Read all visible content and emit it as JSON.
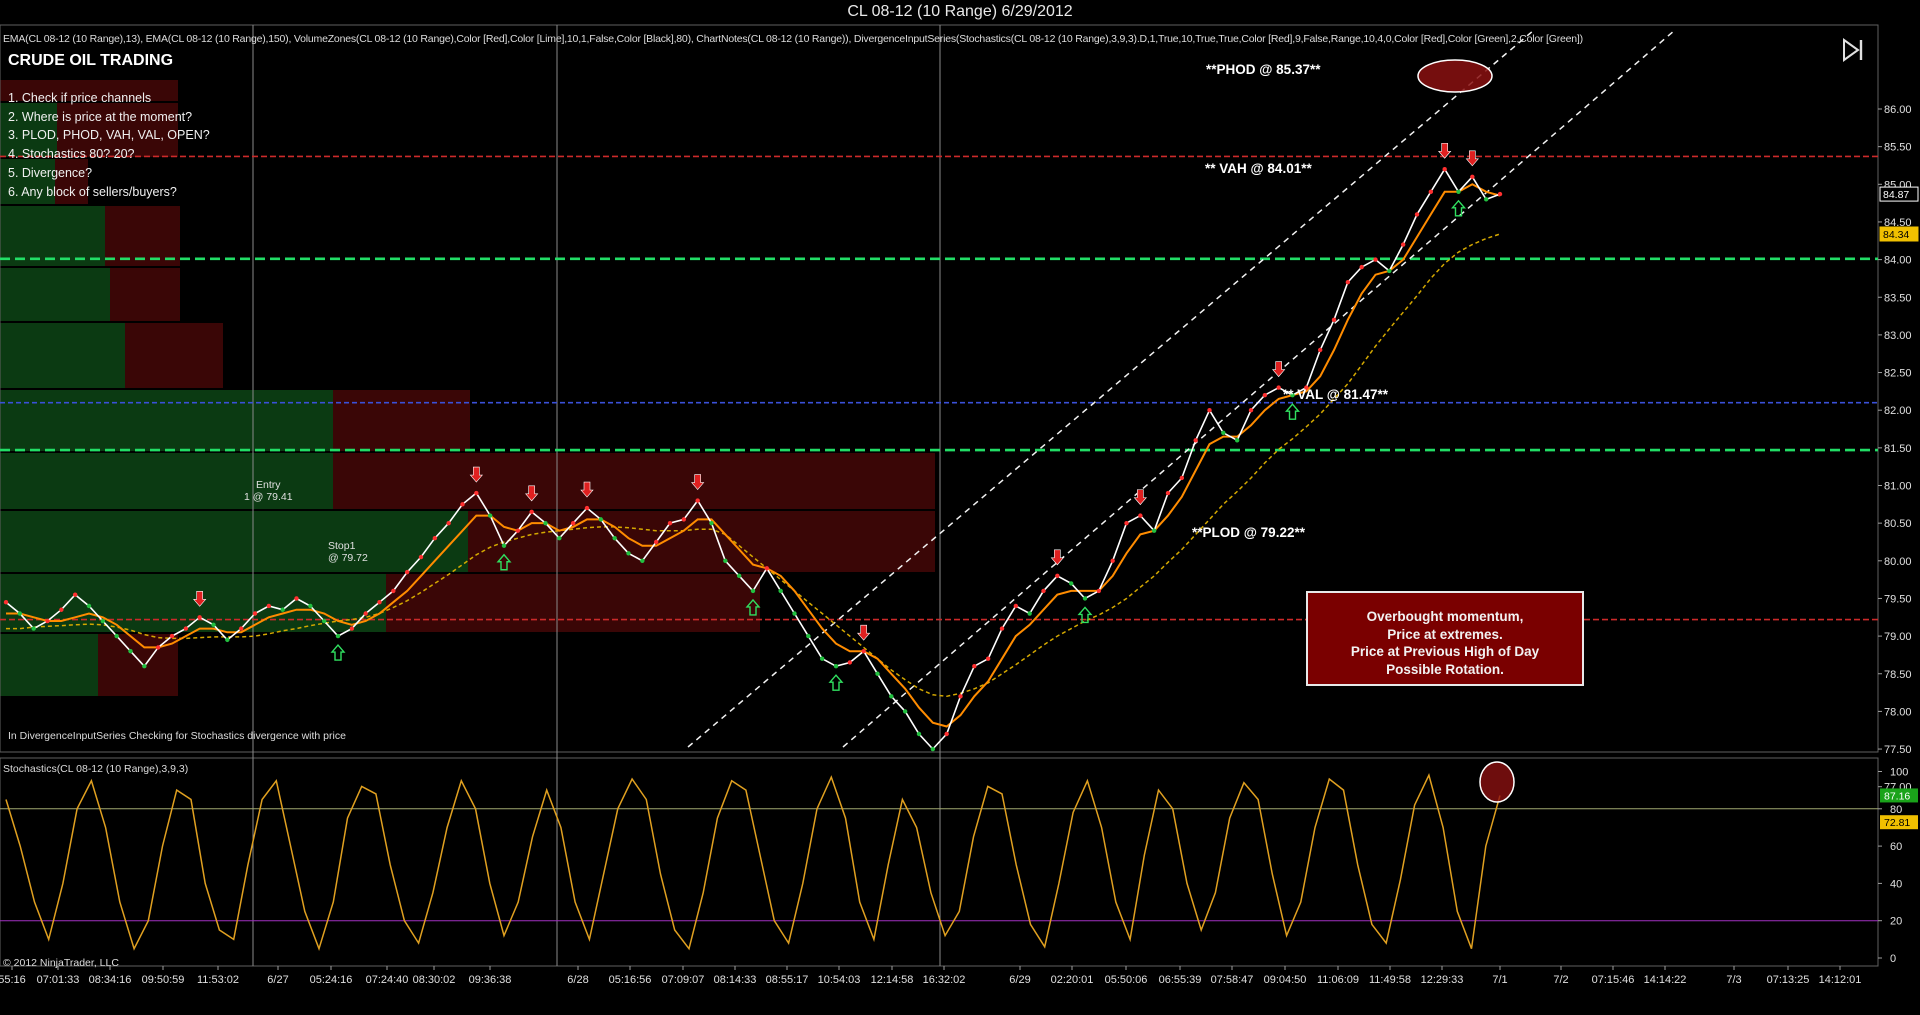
{
  "window": {
    "title": "CL 08-12 (10 Range)  6/29/2012"
  },
  "indicators_line": "EMA(CL 08-12 (10 Range),13), EMA(CL 08-12 (10 Range),150), VolumeZones(CL 08-12 (10 Range),Color [Red],Color [Lime],10,1,False,Color [Black],80), ChartNotes(CL 08-12 (10 Range)), DivergenceInputSeries(Stochastics(CL 08-12 (10 Range),3,9,3).D,1,True,10,True,True,Color [Red],9,False,Range,10,4,0,Color [Red],Color [Green],2,Color [Green])",
  "notes": {
    "title": "CRUDE OIL TRADING",
    "checklist": [
      "1. Check if price channels",
      "2. Where is price at the moment?",
      "3. PLOD, PHOD, VAH, VAL, OPEN?",
      "4. Stochastics 80? 20?",
      "5. Divergence?",
      "6. Any block of sellers/buyers?"
    ],
    "phod": "**PHOD @ 85.37**",
    "vah": "** VAH @ 84.01**",
    "val": "** VAL @ 81.47**",
    "plod": "**PLOD @ 79.22**",
    "entry_label": "Entry",
    "entry_value": "1 @ 79.41",
    "stop_label": "Stop1",
    "stop_value": "@ 79.72",
    "alert_lines": [
      "Overbought momentum,",
      "Price at extremes.",
      "Price at Previous High of Day",
      "Possible Rotation."
    ],
    "divergence_note": "In DivergenceInputSeries Checking for Stochastics  divergence with price",
    "stoch_label": "Stochastics(CL 08-12 (10 Range),3,9,3)",
    "copyright": "© 2012 NinjaTrader, LLC"
  },
  "icons": {
    "nav": "skip-to-end-icon"
  },
  "colors": {
    "background": "#000000",
    "price_line": "#ffffff",
    "ema_fast": "#ff8c00",
    "ema_slow": "#d4a800",
    "stoch_line": "#e0a020",
    "phod_line": "#cc2a2a",
    "vah_line": "#22dd66",
    "blue_line": "#3a50d8",
    "val_line": "#22dd66",
    "plod_line": "#cc2a2a",
    "buy_zone": "#0b3a12",
    "sell_zone": "#3a0606",
    "last_price_tag": "#ffffff",
    "ema_tag": "#f0c000",
    "stoch_tag_green": "#1aa31a",
    "stoch_tag_yellow": "#f0c000"
  },
  "chart_data": [
    {
      "type": "line",
      "panel": "price",
      "ylim": [
        76.7,
        86.05
      ],
      "yticks": [
        77.0,
        77.5,
        78.0,
        78.5,
        79.0,
        79.5,
        80.0,
        80.5,
        81.0,
        81.5,
        82.0,
        82.5,
        83.0,
        83.5,
        84.0,
        84.5,
        85.0,
        85.5,
        86.0
      ],
      "ytick_labels": [
        "77.00",
        "77.50",
        "78.00",
        "78.50",
        "79.00",
        "79.50",
        "80.00",
        "80.50",
        "81.00",
        "81.50",
        "82.00",
        "82.50",
        "83.00",
        "83.50",
        "84.00",
        "84.50",
        "85.00",
        "85.50",
        "86.00"
      ],
      "xtick_labels": [
        "55:16",
        "07:01:33",
        "08:34:16",
        "09:50:59",
        "11:53:02",
        "6/27",
        "05:24:16",
        "07:24:40",
        "08:30:02",
        "09:36:38",
        "6/28",
        "05:16:56",
        "07:09:07",
        "08:14:33",
        "08:55:17",
        "10:54:03",
        "12:14:58",
        "16:32:02",
        "6/29",
        "02:20:01",
        "05:50:06",
        "06:55:39",
        "07:58:47",
        "09:04:50",
        "11:06:09",
        "11:49:58",
        "12:29:33",
        "7/1",
        "7/2",
        "07:15:46",
        "14:14:22",
        "7/3",
        "07:13:25",
        "14:12:01"
      ],
      "last_price": 84.87,
      "last_price_label": "84.87",
      "ema_last": 84.34,
      "ema_last_label": "84.34",
      "horizontal_levels": [
        {
          "name": "PHOD",
          "value": 85.37
        },
        {
          "name": "VAH",
          "value": 84.01
        },
        {
          "name": "mid",
          "value": 82.1
        },
        {
          "name": "VAL",
          "value": 81.47
        },
        {
          "name": "PLOD",
          "value": 79.22
        }
      ],
      "series": [
        {
          "values": [
            79.45,
            79.3,
            79.1,
            79.2,
            79.35,
            79.55,
            79.4,
            79.2,
            79.0,
            78.8,
            78.6,
            78.85,
            79.0,
            79.1,
            79.25,
            79.15,
            78.95,
            79.1,
            79.3,
            79.4,
            79.35,
            79.5,
            79.4,
            79.2,
            79.0,
            79.1,
            79.3,
            79.45,
            79.6,
            79.85,
            80.05,
            80.3,
            80.5,
            80.75,
            80.9,
            80.6,
            80.2,
            80.4,
            80.65,
            80.5,
            80.3,
            80.5,
            80.7,
            80.55,
            80.3,
            80.1,
            80.0,
            80.25,
            80.5,
            80.55,
            80.8,
            80.5,
            80.0,
            79.8,
            79.6,
            79.9,
            79.6,
            79.3,
            79.0,
            78.7,
            78.6,
            78.65,
            78.8,
            78.5,
            78.2,
            78.0,
            77.7,
            77.5,
            77.7,
            78.2,
            78.6,
            78.7,
            79.1,
            79.4,
            79.3,
            79.6,
            79.8,
            79.7,
            79.5,
            79.6,
            80.0,
            80.5,
            80.6,
            80.4,
            80.9,
            81.1,
            81.6,
            82.0,
            81.7,
            81.6,
            82.0,
            82.2,
            82.3,
            82.2,
            82.3,
            82.8,
            83.2,
            83.7,
            83.9,
            84.0,
            83.85,
            84.2,
            84.6,
            84.9,
            85.2,
            84.9,
            85.1,
            84.8,
            84.87
          ]
        },
        {
          "values": [
            79.3,
            79.3,
            79.25,
            79.2,
            79.2,
            79.25,
            79.3,
            79.25,
            79.15,
            79.0,
            78.85,
            78.85,
            78.9,
            79.0,
            79.1,
            79.1,
            79.05,
            79.05,
            79.15,
            79.25,
            79.3,
            79.35,
            79.35,
            79.3,
            79.2,
            79.15,
            79.2,
            79.3,
            79.45,
            79.6,
            79.8,
            80.0,
            80.2,
            80.4,
            80.6,
            80.6,
            80.45,
            80.4,
            80.5,
            80.5,
            80.4,
            80.45,
            80.55,
            80.55,
            80.45,
            80.3,
            80.2,
            80.2,
            80.3,
            80.4,
            80.55,
            80.55,
            80.35,
            80.15,
            79.95,
            79.9,
            79.8,
            79.6,
            79.35,
            79.1,
            78.9,
            78.8,
            78.8,
            78.7,
            78.5,
            78.3,
            78.05,
            77.85,
            77.8,
            77.95,
            78.2,
            78.4,
            78.7,
            79.0,
            79.15,
            79.35,
            79.55,
            79.6,
            79.6,
            79.6,
            79.8,
            80.1,
            80.35,
            80.4,
            80.6,
            80.85,
            81.2,
            81.55,
            81.65,
            81.65,
            81.8,
            82.0,
            82.15,
            82.2,
            82.25,
            82.45,
            82.8,
            83.2,
            83.55,
            83.8,
            83.85,
            84.0,
            84.3,
            84.6,
            84.9,
            84.9,
            85.0,
            84.9,
            84.85
          ]
        },
        {
          "values": [
            79.1,
            79.1,
            79.12,
            79.13,
            79.14,
            79.15,
            79.16,
            79.15,
            79.12,
            79.08,
            79.02,
            78.98,
            78.97,
            78.97,
            78.98,
            78.99,
            78.99,
            78.99,
            79.0,
            79.03,
            79.07,
            79.1,
            79.14,
            79.17,
            79.2,
            79.22,
            79.25,
            79.3,
            79.38,
            79.47,
            79.58,
            79.7,
            79.82,
            79.95,
            80.08,
            80.18,
            80.25,
            80.3,
            80.35,
            80.38,
            80.4,
            80.42,
            80.44,
            80.45,
            80.45,
            80.44,
            80.42,
            80.4,
            80.4,
            80.4,
            80.42,
            80.42,
            80.35,
            80.2,
            80.05,
            79.9,
            79.75,
            79.6,
            79.45,
            79.3,
            79.15,
            79.0,
            78.85,
            78.7,
            78.55,
            78.42,
            78.3,
            78.22,
            78.2,
            78.24,
            78.3,
            78.38,
            78.5,
            78.62,
            78.75,
            78.88,
            79.0,
            79.1,
            79.2,
            79.28,
            79.38,
            79.5,
            79.65,
            79.8,
            79.98,
            80.15,
            80.35,
            80.55,
            80.75,
            80.92,
            81.1,
            81.3,
            81.48,
            81.62,
            81.78,
            81.95,
            82.15,
            82.35,
            82.6,
            82.85,
            83.08,
            83.3,
            83.52,
            83.75,
            83.95,
            84.1,
            84.2,
            84.28,
            84.34
          ]
        }
      ]
    },
    {
      "type": "line",
      "panel": "stochastics",
      "ylim": [
        -5,
        105
      ],
      "yticks": [
        0,
        20,
        40,
        60,
        80,
        100
      ],
      "ytick_labels": [
        "0",
        "20",
        "40",
        "60",
        "80",
        "100"
      ],
      "levels": [
        20,
        80
      ],
      "last_d": 87.16,
      "last_d_label": "87.16",
      "last_k": 72.81,
      "last_k_label": "72.81",
      "series": [
        {
          "values": [
            85,
            60,
            30,
            10,
            40,
            80,
            95,
            70,
            30,
            5,
            20,
            60,
            90,
            85,
            40,
            15,
            10,
            50,
            85,
            95,
            60,
            25,
            5,
            30,
            75,
            92,
            88,
            50,
            20,
            8,
            35,
            70,
            95,
            80,
            40,
            12,
            30,
            65,
            90,
            70,
            30,
            10,
            45,
            80,
            96,
            85,
            45,
            15,
            5,
            35,
            75,
            95,
            90,
            55,
            20,
            8,
            40,
            80,
            97,
            75,
            30,
            10,
            50,
            85,
            70,
            35,
            12,
            25,
            65,
            92,
            88,
            50,
            18,
            6,
            40,
            78,
            95,
            70,
            30,
            10,
            55,
            90,
            80,
            40,
            15,
            35,
            75,
            94,
            85,
            45,
            12,
            30,
            70,
            96,
            90,
            50,
            18,
            8,
            42,
            82,
            98,
            70,
            25,
            5,
            60,
            87.16
          ]
        }
      ]
    }
  ]
}
